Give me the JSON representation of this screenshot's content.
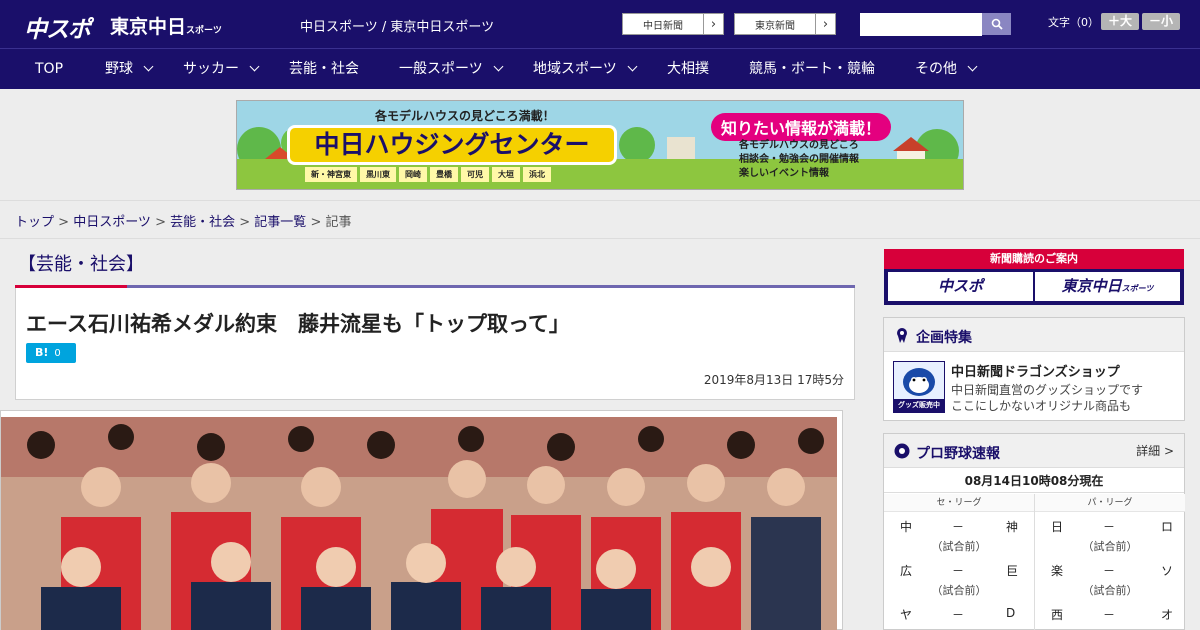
{
  "header": {
    "logo": "中スポ",
    "logo2": "東京中日",
    "logo2_small": "スポーツ",
    "site_title": "中日スポーツ / 東京中日スポーツ",
    "paper_links": [
      {
        "label": "中日新聞"
      },
      {
        "label": "東京新聞"
      }
    ],
    "search_placeholder": "",
    "font_size_label": "文字（0）",
    "font_up": "＋大",
    "font_down": "－小"
  },
  "nav": {
    "items": [
      {
        "label": "TOP",
        "has_menu": false
      },
      {
        "label": "野球",
        "has_menu": true
      },
      {
        "label": "サッカー",
        "has_menu": true
      },
      {
        "label": "芸能・社会",
        "has_menu": false
      },
      {
        "label": "一般スポーツ",
        "has_menu": true
      },
      {
        "label": "地域スポーツ",
        "has_menu": true
      },
      {
        "label": "大相撲",
        "has_menu": false
      },
      {
        "label": "競馬・ボート・競輪",
        "has_menu": false
      },
      {
        "label": "その他",
        "has_menu": true
      }
    ]
  },
  "banner": {
    "headline": "各モデルハウスの見どころ満載！",
    "main": "中日ハウジングセンター",
    "cities": [
      "新・神宮東",
      "黒川東",
      "岡崎",
      "豊橋",
      "可児",
      "大垣",
      "浜北"
    ],
    "tag": "知りたい情報が満載！",
    "info": [
      "各モデルハウスの見どころ",
      "相談会・勉強会の開催情報",
      "楽しいイベント情報"
    ]
  },
  "breadcrumb": {
    "links": [
      "トップ",
      "中日スポーツ",
      "芸能・社会",
      "記事一覧"
    ],
    "current": "記事",
    "sep": " > "
  },
  "article": {
    "category": "【芸能・社会】",
    "title": "エース石川祐希メダル約束　藤井流星も「トップ取って」",
    "hatena_label": "B!",
    "hatena_count": "0",
    "date": "2019年8月13日 17時5分"
  },
  "sidebar": {
    "subscribe_header": "新聞購読のご案内",
    "subscribe_buttons": [
      {
        "label": "中スポ",
        "small": ""
      },
      {
        "label": "東京中日",
        "small": "スポーツ"
      }
    ],
    "kikaku": {
      "title": "企画特集",
      "thumb_text": "グッズ販売中",
      "shop": "中日新聞ドラゴンズショップ",
      "desc1": "中日新聞直営のグッズショップです",
      "desc2": "ここにしかないオリジナル商品も"
    },
    "score": {
      "title": "プロ野球速報",
      "detail": "詳細 >",
      "as_of": "08月14日10時08分現在",
      "leagues": [
        "セ・リーグ",
        "パ・リーグ"
      ],
      "games": [
        {
          "home": "中",
          "away": "神",
          "sep": "－",
          "status": "（試合前）"
        },
        {
          "home": "日",
          "away": "ロ",
          "sep": "－",
          "status": "（試合前）"
        },
        {
          "home": "広",
          "away": "巨",
          "sep": "－",
          "status": "（試合前）"
        },
        {
          "home": "楽",
          "away": "ソ",
          "sep": "－",
          "status": "（試合前）"
        },
        {
          "home": "ヤ",
          "away": "D",
          "sep": "－",
          "status": ""
        },
        {
          "home": "西",
          "away": "オ",
          "sep": "－",
          "status": ""
        }
      ]
    }
  },
  "colors": {
    "navy": "#1a0f6a",
    "red": "#d7003a",
    "purple": "#6f67b0",
    "hatena": "#00a4de"
  }
}
